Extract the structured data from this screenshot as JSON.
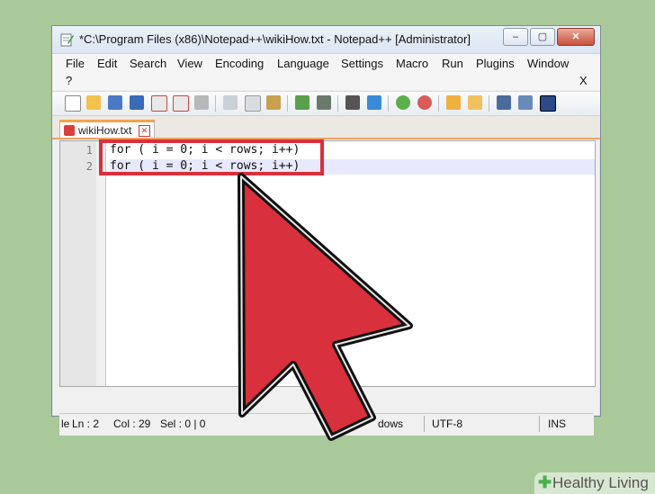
{
  "window": {
    "title": "*C:\\Program Files (x86)\\Notepad++\\wikiHow.txt - Notepad++ [Administrator]",
    "minimize": "–",
    "maximize": "▢",
    "close": "✕"
  },
  "menu": {
    "items": [
      "File",
      "Edit",
      "Search",
      "View",
      "Encoding",
      "Language",
      "Settings",
      "Macro",
      "Run",
      "Plugins",
      "Window"
    ],
    "help": "?",
    "close_doc": "X"
  },
  "toolbar": {
    "icons": [
      "new-file-icon",
      "open-file-icon",
      "save-icon",
      "save-all-icon",
      "close-icon",
      "close-all-icon",
      "print-icon",
      "cut-icon",
      "copy-icon",
      "paste-icon",
      "undo-icon",
      "redo-icon",
      "find-icon",
      "replace-icon",
      "zoom-in-icon",
      "zoom-out-icon",
      "sync-vertical-icon",
      "sync-horizontal-icon",
      "word-wrap-icon",
      "show-all-characters-icon",
      "indent-guide-icon"
    ]
  },
  "tab": {
    "label": "wikiHow.txt",
    "close": "✕"
  },
  "editor": {
    "lines": [
      {
        "number": "1",
        "text": "for ( i = 0; i < rows; i++)"
      },
      {
        "number": "2",
        "text": "for ( i = 0; i < rows; i++)"
      }
    ]
  },
  "status": {
    "left": "le",
    "ln": "Ln : 2",
    "col": "Col : 29",
    "sel": "Sel : 0 | 0",
    "eol": "dows",
    "encoding": "UTF-8",
    "mode": "INS"
  },
  "watermark": {
    "text": "Healthy Living"
  },
  "colors": {
    "background": "#a9c99a",
    "highlight": "#d8303c",
    "arrow": "#d8303c"
  }
}
